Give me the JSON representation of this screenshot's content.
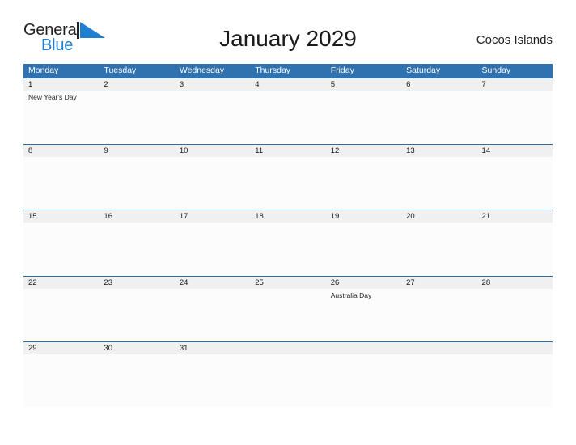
{
  "brand": {
    "name_part1": "General",
    "name_part2": "Blue",
    "flag_icon": "blue-triangle-flag-icon",
    "accent_color": "#1f7fd0",
    "dark_color": "#231f20"
  },
  "header": {
    "title": "January 2029",
    "location": "Cocos Islands"
  },
  "calendar": {
    "header_color": "#3071b0",
    "strip_color": "#f0f0f0",
    "weekday_headers": [
      "Monday",
      "Tuesday",
      "Wednesday",
      "Thursday",
      "Friday",
      "Saturday",
      "Sunday"
    ],
    "weeks": [
      {
        "days": [
          {
            "num": "1",
            "event": "New Year's Day"
          },
          {
            "num": "2",
            "event": ""
          },
          {
            "num": "3",
            "event": ""
          },
          {
            "num": "4",
            "event": ""
          },
          {
            "num": "5",
            "event": ""
          },
          {
            "num": "6",
            "event": ""
          },
          {
            "num": "7",
            "event": ""
          }
        ]
      },
      {
        "days": [
          {
            "num": "8",
            "event": ""
          },
          {
            "num": "9",
            "event": ""
          },
          {
            "num": "10",
            "event": ""
          },
          {
            "num": "11",
            "event": ""
          },
          {
            "num": "12",
            "event": ""
          },
          {
            "num": "13",
            "event": ""
          },
          {
            "num": "14",
            "event": ""
          }
        ]
      },
      {
        "days": [
          {
            "num": "15",
            "event": ""
          },
          {
            "num": "16",
            "event": ""
          },
          {
            "num": "17",
            "event": ""
          },
          {
            "num": "18",
            "event": ""
          },
          {
            "num": "19",
            "event": ""
          },
          {
            "num": "20",
            "event": ""
          },
          {
            "num": "21",
            "event": ""
          }
        ]
      },
      {
        "days": [
          {
            "num": "22",
            "event": ""
          },
          {
            "num": "23",
            "event": ""
          },
          {
            "num": "24",
            "event": ""
          },
          {
            "num": "25",
            "event": ""
          },
          {
            "num": "26",
            "event": "Australia Day"
          },
          {
            "num": "27",
            "event": ""
          },
          {
            "num": "28",
            "event": ""
          }
        ]
      },
      {
        "days": [
          {
            "num": "29",
            "event": ""
          },
          {
            "num": "30",
            "event": ""
          },
          {
            "num": "31",
            "event": ""
          },
          {
            "num": "",
            "event": ""
          },
          {
            "num": "",
            "event": ""
          },
          {
            "num": "",
            "event": ""
          },
          {
            "num": "",
            "event": ""
          }
        ]
      }
    ]
  }
}
